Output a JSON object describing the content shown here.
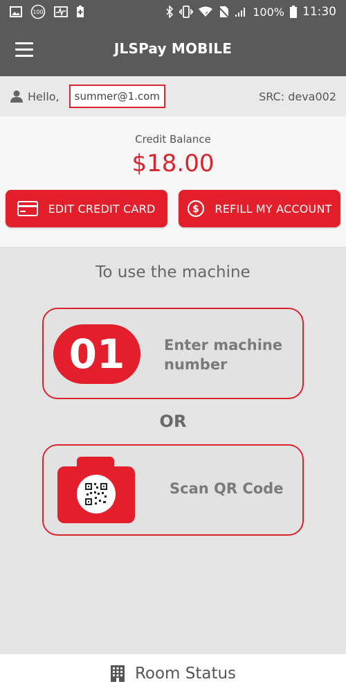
{
  "statusbar": {
    "battery_percent": "100%",
    "time": "11:30",
    "notif_badge": "100",
    "icons": [
      "image-icon",
      "badge-100-icon",
      "activity-icon",
      "battery-plus-icon",
      "bluetooth-icon",
      "vibrate-icon",
      "wifi-icon",
      "no-sim-icon",
      "signal-icon",
      "battery-icon"
    ]
  },
  "appbar": {
    "title": "JLSPay MOBILE"
  },
  "user": {
    "greeting": "Hello,",
    "email": "summer@1.com",
    "src": "SRC: deva002"
  },
  "balance": {
    "label": "Credit Balance",
    "amount": "$18.00"
  },
  "actions": {
    "edit_card": "EDIT CREDIT CARD",
    "refill": "REFILL MY ACCOUNT"
  },
  "instructions": {
    "title": "To use the machine",
    "machine_badge": "01",
    "machine_line1": "Enter machine",
    "machine_line2": "number",
    "or": "OR",
    "scan": "Scan QR Code"
  },
  "bottom": {
    "room_status": "Room Status"
  },
  "colors": {
    "accent": "#e21f2a",
    "header": "#5a5a5a",
    "background": "#e4e4e4"
  }
}
